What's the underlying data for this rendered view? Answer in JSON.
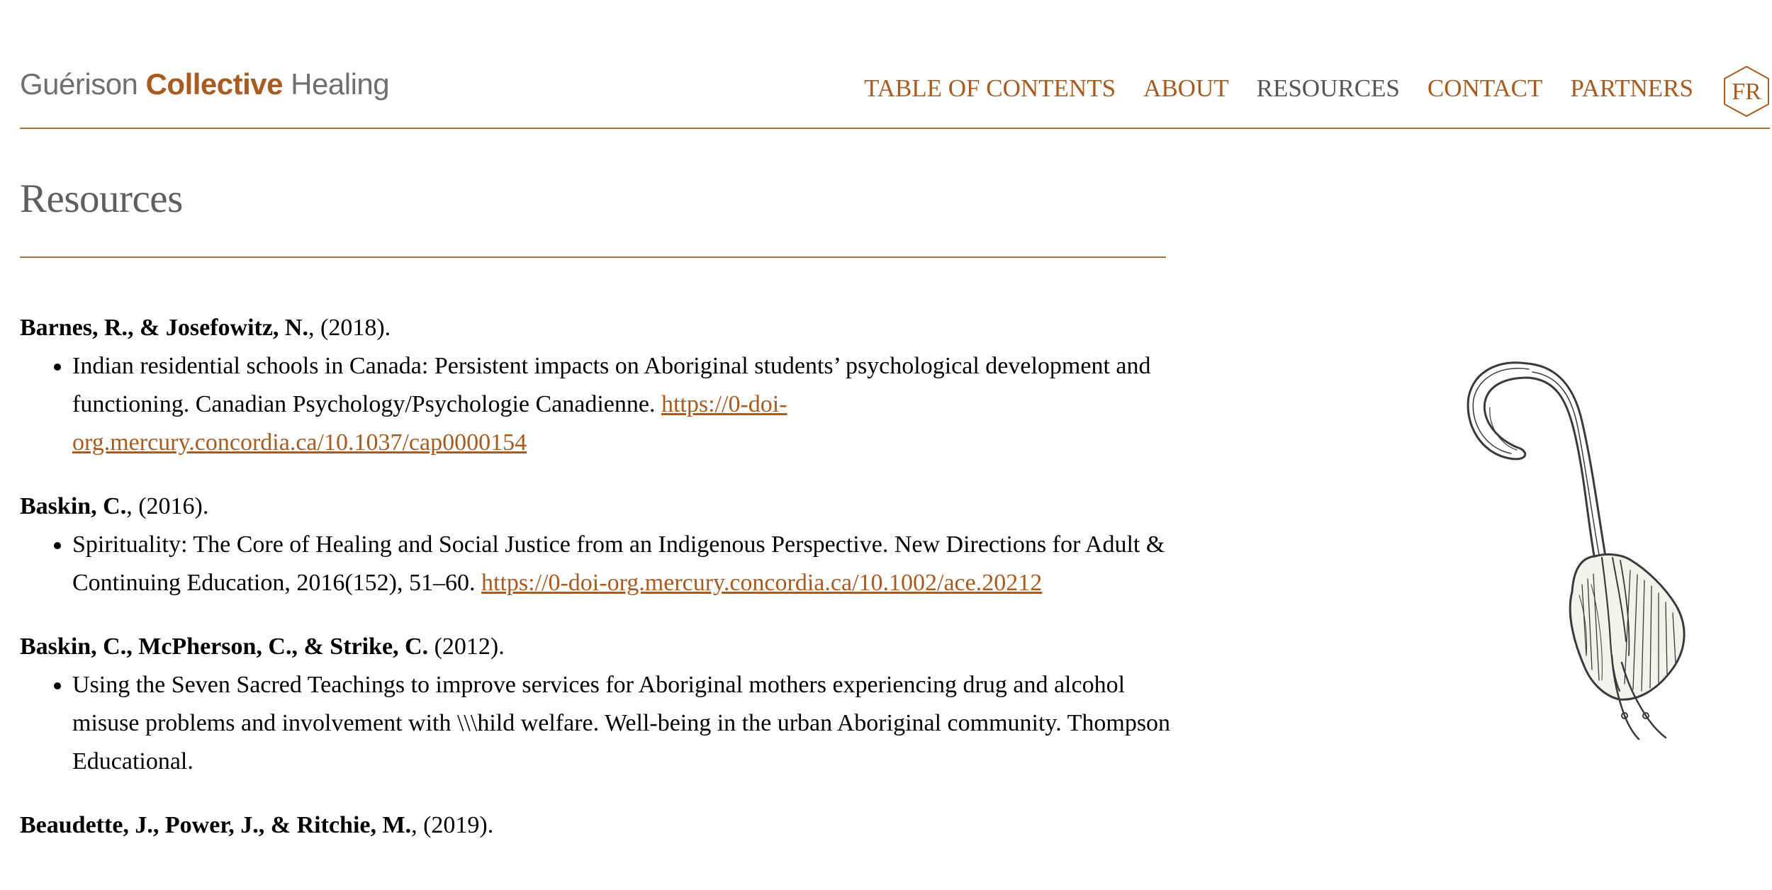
{
  "header": {
    "logo": {
      "part1": "Guérison ",
      "part2": "Collective",
      "part3": " Healing"
    },
    "nav": [
      {
        "label": "TABLE OF CONTENTS"
      },
      {
        "label": "ABOUT"
      },
      {
        "label": "RESOURCES"
      },
      {
        "label": "CONTACT"
      },
      {
        "label": "PARTNERS"
      }
    ],
    "language_toggle": "FR"
  },
  "page": {
    "title": "Resources"
  },
  "references": [
    {
      "authors": "Barnes, R., & Josefowitz, N.",
      "year": ", (2018).",
      "text": "Indian residential schools in Canada: Persistent impacts on Aboriginal students’ psychological development and functioning. Canadian Psychology/Psychologie Canadienne. ",
      "link": "https://0-doi-org.mercury.concordia.ca/10.1037/cap0000154"
    },
    {
      "authors": "Baskin, C.",
      "year": ", (2016).",
      "text": "Spirituality: The Core of Healing and Social Justice from an Indigenous Perspective. New Directions for Adult & Continuing Education, 2016(152), 51–60. ",
      "link": "https://0-doi-org.mercury.concordia.ca/10.1002/ace.20212"
    },
    {
      "authors": "Baskin, C., McPherson, C., & Strike, C.",
      "year": " (2012).",
      "text": "Using the Seven Sacred Teachings to improve services for Aboriginal mothers experiencing drug and alcohol misuse problems and involvement with \\\\\\hild welfare. Well-being in the urban Aboriginal community. Thompson Educational.",
      "link": ""
    },
    {
      "authors": "Beaudette, J., Power, J., & Ritchie, M.",
      "year": ", (2019).",
      "text": "",
      "link": ""
    }
  ],
  "colors": {
    "accent": "#a95a1f",
    "rule": "#b0703c",
    "logo_gray": "#6f6f6f",
    "title_gray": "#5f5f5f",
    "nav_current": "#555555"
  }
}
